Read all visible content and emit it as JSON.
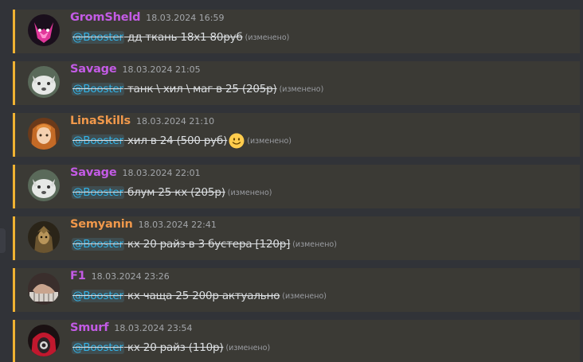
{
  "colors": {
    "background": "#313338",
    "message_highlight": "#3b3a35",
    "highlight_bar": "#f0b232",
    "mention_text": "#33b4e8",
    "timestamp": "#a3a6aa"
  },
  "messages": [
    {
      "author": "GromSheld",
      "author_color": "#c35be5",
      "avatar": "pink-fox-mask-avatar",
      "timestamp": "18.03.2024 16:59",
      "mention": "@Booster",
      "text": " дд ткань 18х1 80руб",
      "edited": "(изменено)"
    },
    {
      "author": "Savage",
      "author_color": "#c35be5",
      "avatar": "white-wolf-avatar",
      "timestamp": "18.03.2024 21:05",
      "mention": "@Booster",
      "text": " танк \\ хил \\ маг в 25 (205р)",
      "edited": "(изменено)"
    },
    {
      "author": "LinaSkills",
      "author_color": "#f0984b",
      "avatar": "anime-girl-avatar",
      "timestamp": "18.03.2024 21:10",
      "mention": "@Booster",
      "text": " хил в 24 (500 руб)",
      "emoji": "slightly-smiling-face-emoji",
      "edited": "(изменено)"
    },
    {
      "author": "Savage",
      "author_color": "#c35be5",
      "avatar": "white-wolf-avatar",
      "timestamp": "18.03.2024 22:01",
      "mention": "@Booster",
      "text": " блум 25 кх (205р)",
      "edited": "(изменено)"
    },
    {
      "author": "Semyanin",
      "author_color": "#f0984b",
      "avatar": "dark-warrior-avatar",
      "timestamp": "18.03.2024 22:41",
      "mention": "@Booster",
      "text": " кх 20 райз в 3 бустера [120р]",
      "edited": "(изменено)"
    },
    {
      "author": "F1",
      "author_color": "#c35be5",
      "avatar": "piano-hands-avatar",
      "timestamp": "18.03.2024 23:26",
      "mention": "@Booster",
      "text": " кх чаща 25 200р актуально",
      "edited": "(изменено)"
    },
    {
      "author": "Smurf",
      "author_color": "#c35be5",
      "avatar": "red-hood-avatar",
      "timestamp": "18.03.2024 23:54",
      "mention": "@Booster",
      "text": " кх 20 райз (110р)",
      "edited": "(изменено)"
    }
  ]
}
